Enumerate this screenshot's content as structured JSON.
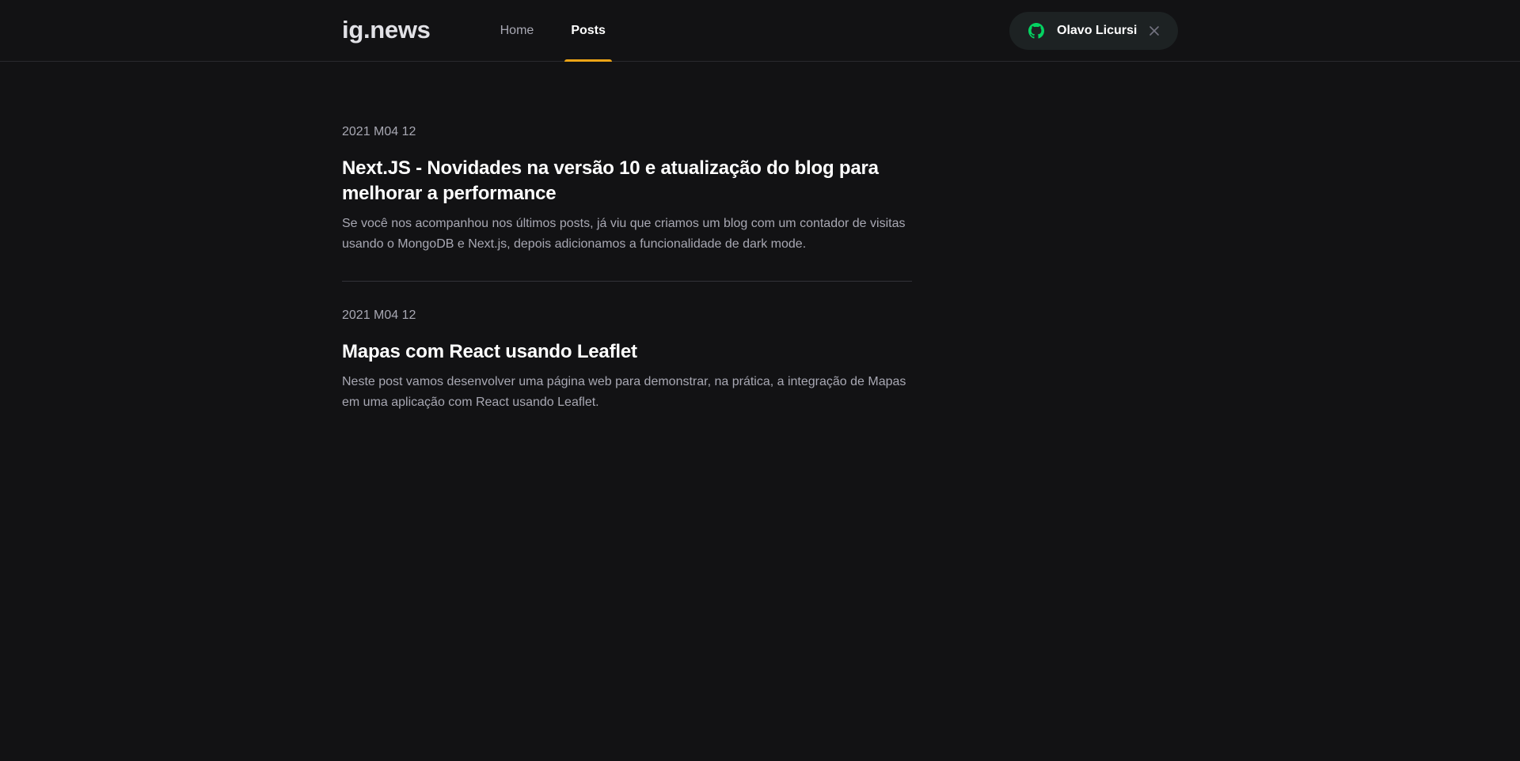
{
  "header": {
    "logo_text": "ig",
    "logo_dot": ".",
    "logo_suffix": "news",
    "nav": [
      {
        "label": "Home",
        "active": false
      },
      {
        "label": "Posts",
        "active": true
      }
    ],
    "signin": {
      "user_name": "Olavo Licursi",
      "github_icon": "github-icon",
      "close_icon": "close-icon"
    }
  },
  "posts": [
    {
      "date": "2021 M04 12",
      "title": "Next.JS - Novidades na versão 10 e atualização do blog para melhorar a performance",
      "excerpt": "Se você nos acompanhou nos últimos posts, já viu que criamos um blog com um contador de visitas usando o MongoDB e Next.js, depois adicionamos a funcionalidade de dark mode."
    },
    {
      "date": "2021 M04 12",
      "title": "Mapas com React usando Leaflet",
      "excerpt": "Neste post vamos desenvolver uma página web para demonstrar, na prática, a integração de Mapas em uma aplicação com React usando Leaflet."
    }
  ],
  "colors": {
    "background": "#121214",
    "accent": "#eba417",
    "github_green": "#04d361",
    "signin_bg": "#1d2223",
    "text_muted": "#a8a8b3"
  }
}
